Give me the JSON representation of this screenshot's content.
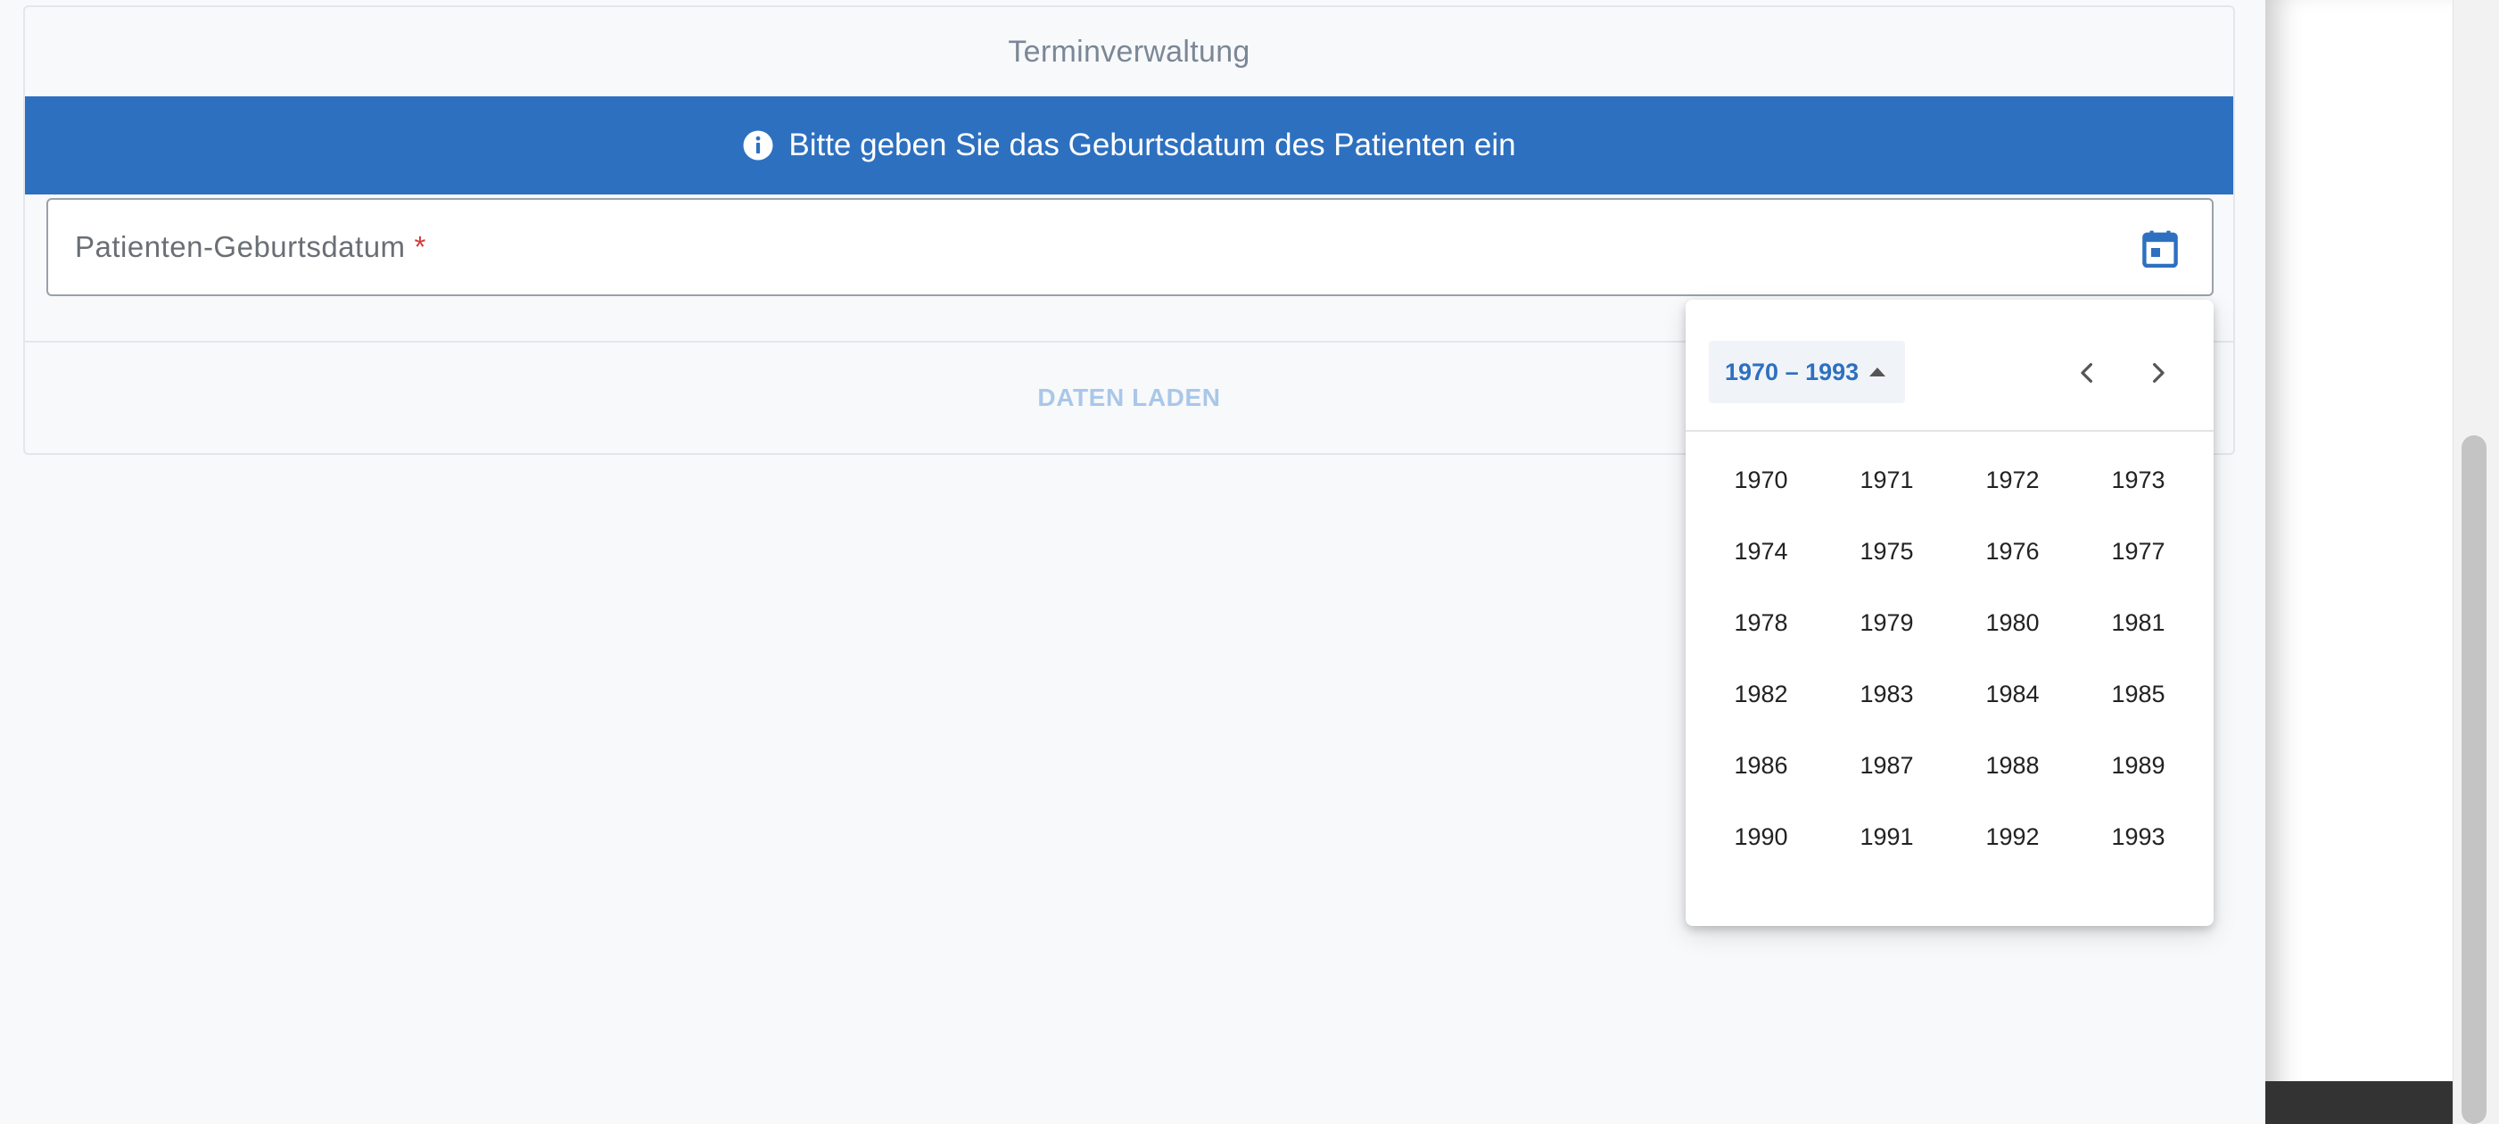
{
  "card": {
    "header_title": "Terminverwaltung",
    "banner_text": "Bitte geben Sie das Geburtsdatum des Patienten ein",
    "field_label": "Patienten-Geburtsdatum",
    "required_marker": "*",
    "load_button_label": "DATEN LADEN"
  },
  "datepicker": {
    "period_label": "1970 – 1993",
    "years": [
      "1970",
      "1971",
      "1972",
      "1973",
      "1974",
      "1975",
      "1976",
      "1977",
      "1978",
      "1979",
      "1980",
      "1981",
      "1982",
      "1983",
      "1984",
      "1985",
      "1986",
      "1987",
      "1988",
      "1989",
      "1990",
      "1991",
      "1992",
      "1993"
    ]
  },
  "icons": {
    "info": "info-circle-icon",
    "calendar": "calendar-icon",
    "caret": "caret-up-icon",
    "prev": "chevron-left-icon",
    "next": "chevron-right-icon"
  },
  "colors": {
    "primary": "#2d70c0",
    "banner_text": "#ffffff",
    "required": "#d33b3b",
    "disabled_button_text": "#a9c7e8"
  }
}
